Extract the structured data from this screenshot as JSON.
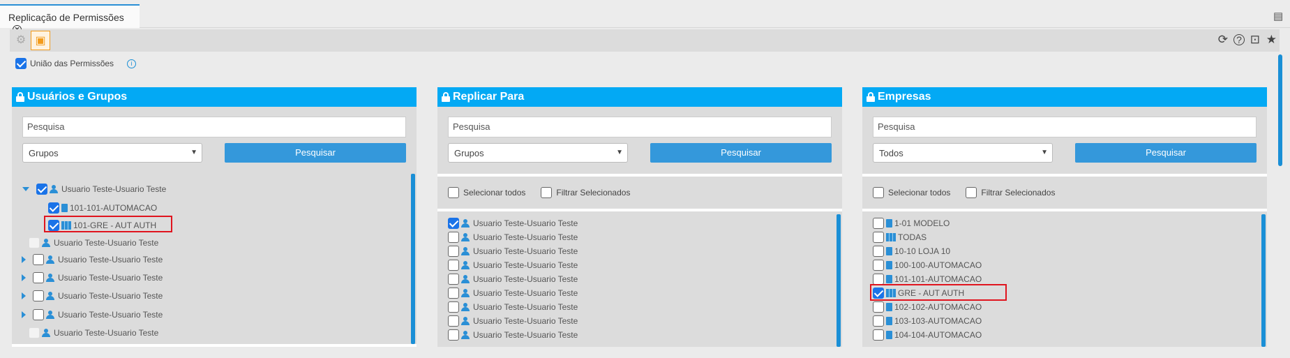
{
  "tab": {
    "title": "Replicação de Permissões"
  },
  "options": {
    "union_label": "União das Permissões"
  },
  "panels": [
    {
      "title": "Usuários e Grupos",
      "search_placeholder": "Pesquisa",
      "filter_value": "Grupos",
      "button": "Pesquisar",
      "items": [
        "Usuario Teste-Usuario Teste",
        "101-101-AUTOMACAO",
        "101-GRE - AUT AUTH",
        "Usuario Teste-Usuario Teste",
        "Usuario Teste-Usuario Teste",
        "Usuario Teste-Usuario Teste",
        "Usuario Teste-Usuario Teste",
        "Usuario Teste-Usuario Teste",
        "Usuario Teste-Usuario Teste"
      ]
    },
    {
      "title": "Replicar Para",
      "search_placeholder": "Pesquisa",
      "filter_value": "Grupos",
      "button": "Pesquisar",
      "select_all": "Selecionar todos",
      "filter_selected": "Filtrar Selecionados",
      "items": [
        "Usuario Teste-Usuario Teste",
        "Usuario Teste-Usuario Teste",
        "Usuario Teste-Usuario Teste",
        "Usuario Teste-Usuario Teste",
        "Usuario Teste-Usuario Teste",
        "Usuario Teste-Usuario Teste",
        "Usuario Teste-Usuario Teste",
        "Usuario Teste-Usuario Teste",
        "Usuario Teste-Usuario Teste"
      ]
    },
    {
      "title": "Empresas",
      "search_placeholder": "Pesquisa",
      "filter_value": "Todos",
      "button": "Pesquisar",
      "select_all": "Selecionar todos",
      "filter_selected": "Filtrar Selecionados",
      "items": [
        "1-01 MODELO",
        "TODAS",
        "10-10 LOJA 10",
        "100-100-AUTOMACAO",
        "101-101-AUTOMACAO",
        "GRE - AUT AUTH",
        "102-102-AUTOMACAO",
        "103-103-AUTOMACAO",
        "104-104-AUTOMACAO"
      ]
    }
  ]
}
